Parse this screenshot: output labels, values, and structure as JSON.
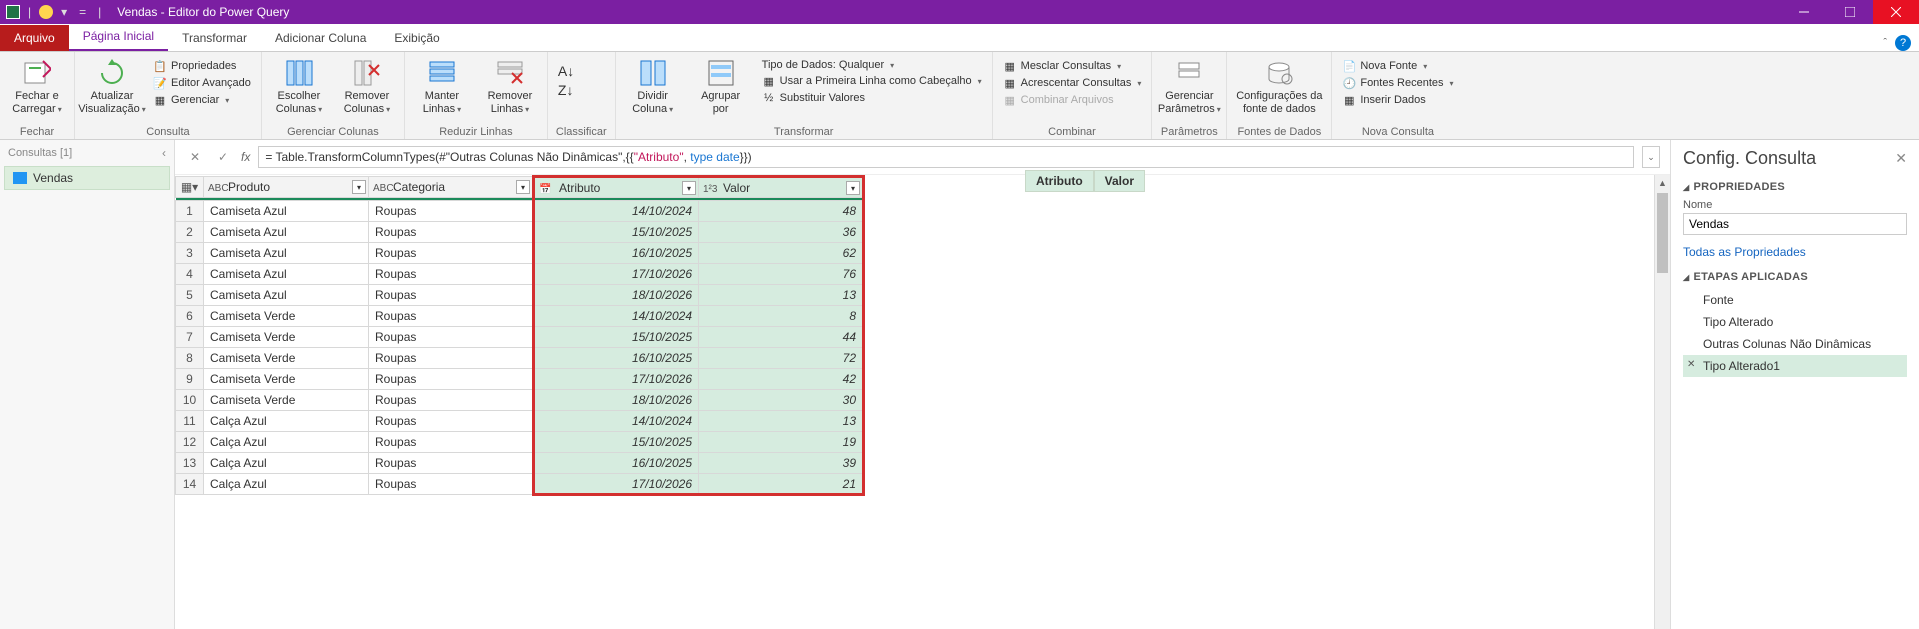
{
  "titlebar": {
    "title": "Vendas - Editor do Power Query"
  },
  "tabs": {
    "file": "Arquivo",
    "items": [
      "Página Inicial",
      "Transformar",
      "Adicionar Coluna",
      "Exibição"
    ],
    "active": 0
  },
  "ribbon": {
    "close_group": {
      "btn": "Fechar e\nCarregar",
      "label": "Fechar"
    },
    "query_group": {
      "btn": "Atualizar\nVisualização",
      "props": "Propriedades",
      "adv": "Editor Avançado",
      "manage": "Gerenciar",
      "label": "Consulta"
    },
    "cols_group": {
      "choose": "Escolher\nColunas",
      "remove": "Remover\nColunas",
      "label": "Gerenciar Colunas"
    },
    "rows_group": {
      "keep": "Manter\nLinhas",
      "remove": "Remover\nLinhas",
      "label": "Reduzir Linhas"
    },
    "sort_group": {
      "label": "Classificar"
    },
    "transform_group": {
      "split": "Dividir\nColuna",
      "group": "Agrupar\npor",
      "dtype": "Tipo de Dados: Qualquer",
      "firstrow": "Usar a Primeira Linha como Cabeçalho",
      "replace": "Substituir Valores",
      "label": "Transformar"
    },
    "combine_group": {
      "merge": "Mesclar Consultas",
      "append": "Acrescentar Consultas",
      "files": "Combinar Arquivos",
      "label": "Combinar"
    },
    "params_group": {
      "btn": "Gerenciar\nParâmetros",
      "label": "Parâmetros"
    },
    "ds_group": {
      "btn": "Configurações da\nfonte de dados",
      "label": "Fontes de Dados"
    },
    "newq_group": {
      "new": "Nova Fonte",
      "recent": "Fontes Recentes",
      "enter": "Inserir Dados",
      "label": "Nova Consulta"
    }
  },
  "queries": {
    "header": "Consultas [1]",
    "item": "Vendas"
  },
  "formula": {
    "prefix": "= Table.TransformColumnTypes(#\"Outras Colunas Não Dinâmicas\",{{",
    "str": "\"Atributo\"",
    "mid": ", ",
    "kw": "type date",
    "suffix": "}})"
  },
  "grid": {
    "headers": {
      "produto": "Produto",
      "categoria": "Categoria",
      "atributo": "Atributo",
      "valor": "Valor"
    },
    "typeicons": {
      "abc": "ABC",
      "date": "📅",
      "num": "1²3"
    },
    "rows": [
      {
        "produto": "Camiseta Azul",
        "categoria": "Roupas",
        "atributo": "14/10/2024",
        "valor": "48"
      },
      {
        "produto": "Camiseta Azul",
        "categoria": "Roupas",
        "atributo": "15/10/2025",
        "valor": "36"
      },
      {
        "produto": "Camiseta Azul",
        "categoria": "Roupas",
        "atributo": "16/10/2025",
        "valor": "62"
      },
      {
        "produto": "Camiseta Azul",
        "categoria": "Roupas",
        "atributo": "17/10/2026",
        "valor": "76"
      },
      {
        "produto": "Camiseta Azul",
        "categoria": "Roupas",
        "atributo": "18/10/2026",
        "valor": "13"
      },
      {
        "produto": "Camiseta Verde",
        "categoria": "Roupas",
        "atributo": "14/10/2024",
        "valor": "8"
      },
      {
        "produto": "Camiseta Verde",
        "categoria": "Roupas",
        "atributo": "15/10/2025",
        "valor": "44"
      },
      {
        "produto": "Camiseta Verde",
        "categoria": "Roupas",
        "atributo": "16/10/2025",
        "valor": "72"
      },
      {
        "produto": "Camiseta Verde",
        "categoria": "Roupas",
        "atributo": "17/10/2026",
        "valor": "42"
      },
      {
        "produto": "Camiseta Verde",
        "categoria": "Roupas",
        "atributo": "18/10/2026",
        "valor": "30"
      },
      {
        "produto": "Calça Azul",
        "categoria": "Roupas",
        "atributo": "14/10/2024",
        "valor": "13"
      },
      {
        "produto": "Calça Azul",
        "categoria": "Roupas",
        "atributo": "15/10/2025",
        "valor": "19"
      },
      {
        "produto": "Calça Azul",
        "categoria": "Roupas",
        "atributo": "16/10/2025",
        "valor": "39"
      },
      {
        "produto": "Calça Azul",
        "categoria": "Roupas",
        "atributo": "17/10/2026",
        "valor": "21"
      }
    ]
  },
  "miniheader": {
    "a": "Atributo",
    "b": "Valor"
  },
  "settings": {
    "title": "Config. Consulta",
    "props_title": "PROPRIEDADES",
    "name_label": "Nome",
    "name_value": "Vendas",
    "all_props": "Todas as Propriedades",
    "steps_title": "ETAPAS APLICADAS",
    "steps": [
      "Fonte",
      "Tipo Alterado",
      "Outras Colunas Não Dinâmicas",
      "Tipo Alterado1"
    ],
    "active_step": 3
  }
}
